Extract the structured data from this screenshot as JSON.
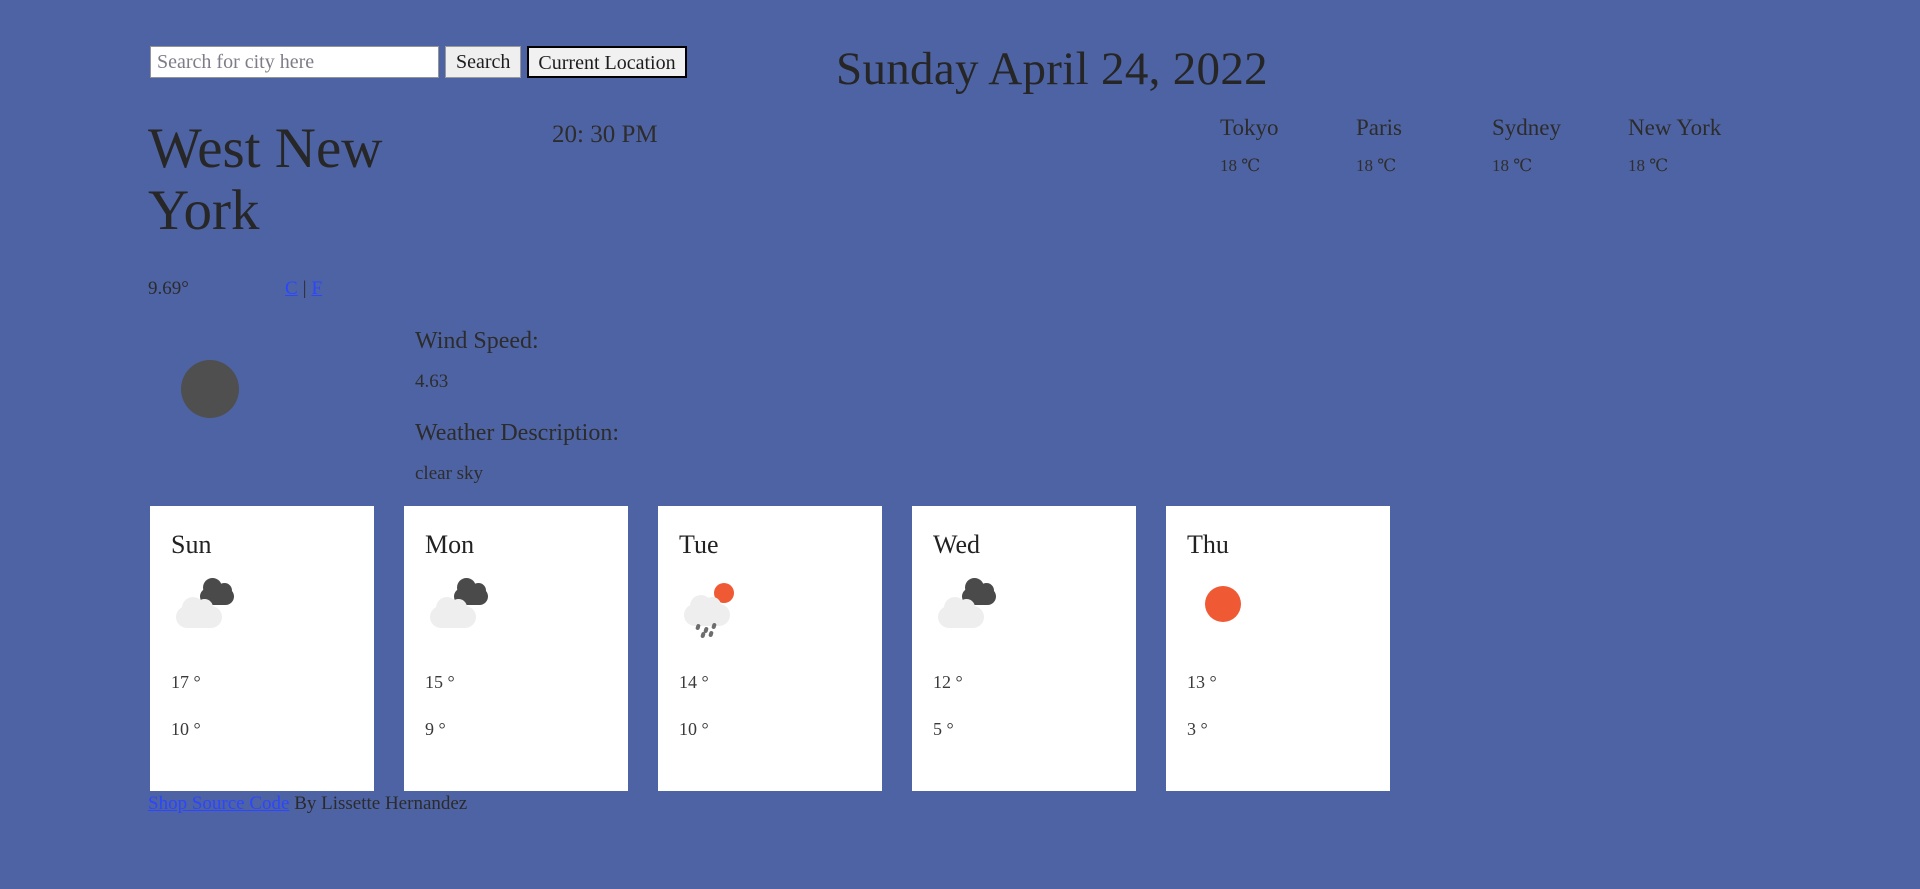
{
  "theme": {
    "background": "#4e63a3",
    "card_background": "#ffffff",
    "link_color": "#2c45ff",
    "sun_color": "#ef5a35",
    "cloud_light": "#eeeeee",
    "cloud_dark": "#4a4a4a",
    "condition_icon_color": "#4f4f4f"
  },
  "search": {
    "placeholder": "Search for city here",
    "value": "",
    "search_button": "Search",
    "current_location_button": "Current Location"
  },
  "header": {
    "date": "Sunday April 24, 2022"
  },
  "world_clocks": [
    {
      "city": "Tokyo",
      "temp": "18 ℃"
    },
    {
      "city": "Paris",
      "temp": "18 ℃"
    },
    {
      "city": "Sydney",
      "temp": "18 ℃"
    },
    {
      "city": "New York",
      "temp": "18 ℃"
    }
  ],
  "current": {
    "city": "West New York",
    "time": "20: 30 PM",
    "temperature": "9.69°",
    "unit_celsius": "C",
    "unit_separator": "|",
    "unit_fahrenheit": "F",
    "icon": "cloud-circle-icon",
    "wind_speed_label": "Wind Speed:",
    "wind_speed_value": "4.63",
    "description_label": "Weather Description:",
    "description_value": "clear sky"
  },
  "forecast": [
    {
      "day": "Sun",
      "icon": "cloudy-icon",
      "high": "17 °",
      "low": "10 °"
    },
    {
      "day": "Mon",
      "icon": "cloudy-icon",
      "high": "15 °",
      "low": "9 °"
    },
    {
      "day": "Tue",
      "icon": "rain-sun-icon",
      "high": "14 °",
      "low": "10 °"
    },
    {
      "day": "Wed",
      "icon": "cloudy-icon",
      "high": "12 °",
      "low": "5 °"
    },
    {
      "day": "Thu",
      "icon": "sun-icon",
      "high": "13 °",
      "low": "3 °"
    }
  ],
  "footer": {
    "link_text": "Shop Source Code",
    "credit": " By Lissette Hernandez"
  }
}
